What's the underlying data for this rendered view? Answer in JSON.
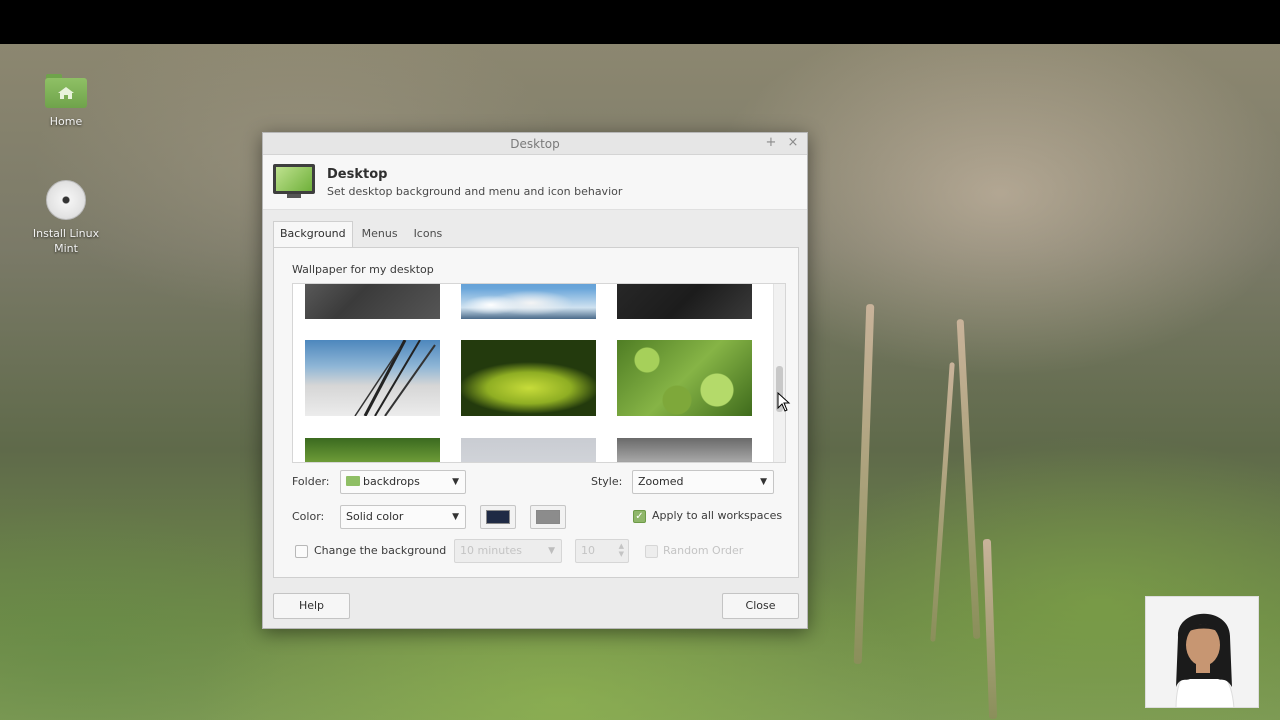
{
  "desktop": {
    "icons": [
      {
        "label": "Home"
      },
      {
        "label": "Install Linux\nMint"
      }
    ]
  },
  "window": {
    "title": "Desktop",
    "header_title": "Desktop",
    "header_subtitle": "Set desktop background and menu and icon behavior"
  },
  "tabs": [
    {
      "label": "Background",
      "active": true
    },
    {
      "label": "Menus",
      "active": false
    },
    {
      "label": "Icons",
      "active": false
    }
  ],
  "background": {
    "wallpaper_label": "Wallpaper for my desktop",
    "folder_label": "Folder:",
    "folder_value": "backdrops",
    "style_label": "Style:",
    "style_value": "Zoomed",
    "color_label": "Color:",
    "color_value": "Solid color",
    "primary_color": "#1f2a44",
    "secondary_color": "#8c8c8c",
    "apply_all_label": "Apply to all workspaces",
    "apply_all_checked": true,
    "change_bg_label": "Change the background",
    "change_bg_checked": false,
    "interval_value": "10 minutes",
    "interval_count": "10",
    "random_order_label": "Random Order"
  },
  "buttons": {
    "help": "Help",
    "close": "Close"
  }
}
